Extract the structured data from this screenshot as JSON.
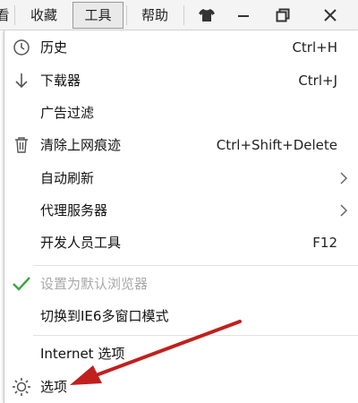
{
  "menubar": {
    "items": [
      {
        "label": "看"
      },
      {
        "label": "收藏"
      },
      {
        "label": "工具"
      },
      {
        "label": "帮助"
      }
    ],
    "window_buttons": [
      "skin-icon",
      "minimize-icon",
      "restore-icon",
      "close-icon"
    ]
  },
  "dropdown": {
    "items": [
      {
        "label": "历史",
        "shortcut": "Ctrl+H",
        "icon": "clock-icon"
      },
      {
        "label": "下载器",
        "shortcut": "Ctrl+J",
        "icon": "download-arrow-icon"
      },
      {
        "label": "广告过滤",
        "shortcut": "",
        "icon": ""
      },
      {
        "label": "清除上网痕迹",
        "shortcut": "Ctrl+Shift+Delete",
        "icon": "trash-icon"
      },
      {
        "label": "自动刷新",
        "shortcut": "",
        "icon": "",
        "submenu": true
      },
      {
        "label": "代理服务器",
        "shortcut": "",
        "icon": "",
        "submenu": true
      },
      {
        "label": "开发人员工具",
        "shortcut": "F12",
        "icon": ""
      },
      {
        "label": "设置为默认浏览器",
        "shortcut": "",
        "icon": "checkmark-icon",
        "disabled": true
      },
      {
        "label": "切换到IE6多窗口模式",
        "shortcut": "",
        "icon": ""
      },
      {
        "label": "Internet 选项",
        "shortcut": "",
        "icon": ""
      },
      {
        "label": "选项",
        "shortcut": "",
        "icon": "gear-icon"
      }
    ]
  },
  "colors": {
    "check_green": "#3aa83a",
    "annotation_arrow": "#c0201e",
    "disabled_text": "#a9a9a9"
  }
}
